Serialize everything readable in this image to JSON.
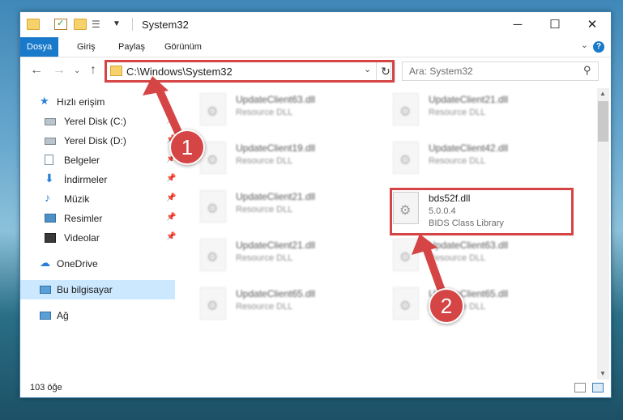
{
  "title": "System32",
  "ribbon": {
    "tabs": [
      "Dosya",
      "Giriş",
      "Paylaş",
      "Görünüm"
    ],
    "active": "Dosya"
  },
  "address": {
    "path": "C:\\Windows\\System32",
    "search_placeholder": "Ara: System32"
  },
  "nav": {
    "items": [
      {
        "label": "Hızlı erişim",
        "icon": "star-icon"
      },
      {
        "label": "Yerel Disk (C:)",
        "icon": "drive-icon",
        "pinned": true
      },
      {
        "label": "Yerel Disk (D:)",
        "icon": "drive-icon",
        "pinned": true
      },
      {
        "label": "Belgeler",
        "icon": "documents-icon",
        "pinned": true
      },
      {
        "label": "İndirmeler",
        "icon": "download-icon",
        "pinned": true
      },
      {
        "label": "Müzik",
        "icon": "music-icon",
        "pinned": true
      },
      {
        "label": "Resimler",
        "icon": "pictures-icon",
        "pinned": true
      },
      {
        "label": "Videolar",
        "icon": "videos-icon",
        "pinned": true
      },
      {
        "label": "OneDrive",
        "icon": "cloud-icon"
      },
      {
        "label": "Bu bilgisayar",
        "icon": "computer-icon",
        "selected": true
      },
      {
        "label": "Ağ",
        "icon": "network-icon"
      }
    ]
  },
  "files": [
    {
      "name": "UpdateClient63.dll",
      "type": "Resource DLL"
    },
    {
      "name": "UpdateClient21.dll",
      "type": "Resource DLL"
    },
    {
      "name": "UpdateClient19.dll",
      "type": "Resource DLL"
    },
    {
      "name": "UpdateClient42.dll",
      "type": "Resource DLL"
    },
    {
      "name": "UpdateClient21.dll",
      "type": "Resource DLL"
    },
    {
      "name": "bds52f.dll",
      "version": "5.0.0.4",
      "type": "BIDS Class Library",
      "highlighted": true
    },
    {
      "name": "UpdateClient21.dll",
      "type": "Resource DLL"
    },
    {
      "name": "UpdateClient63.dll",
      "type": "Resource DLL"
    },
    {
      "name": "UpdateClient65.dll",
      "type": "Resource DLL"
    },
    {
      "name": "UpdateClient65.dll",
      "type": "Resource DLL"
    }
  ],
  "status": {
    "count": "103 öğe"
  },
  "callouts": [
    "1",
    "2"
  ],
  "colors": {
    "accent": "#1979ca",
    "annotation": "#d64545",
    "selection": "#cce8ff"
  }
}
